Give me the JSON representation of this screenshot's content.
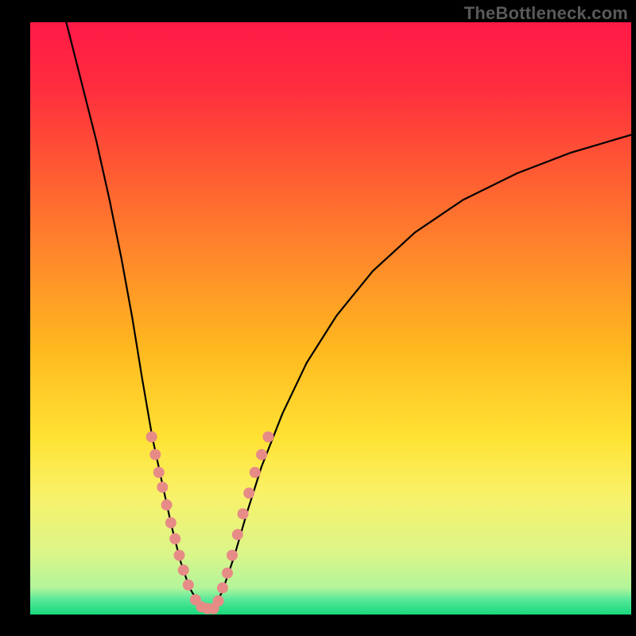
{
  "watermark": "TheBottleneck.com",
  "chart_data": {
    "type": "line",
    "title": "",
    "xlabel": "",
    "ylabel": "",
    "x_range": [
      0,
      100
    ],
    "y_range": [
      0,
      100
    ],
    "gradient_stops": [
      {
        "offset": 0.0,
        "color": "#ff1a47"
      },
      {
        "offset": 0.1,
        "color": "#ff2a3f"
      },
      {
        "offset": 0.25,
        "color": "#ff5a33"
      },
      {
        "offset": 0.4,
        "color": "#ff8a2a"
      },
      {
        "offset": 0.55,
        "color": "#ffb81f"
      },
      {
        "offset": 0.7,
        "color": "#ffe233"
      },
      {
        "offset": 0.8,
        "color": "#f8f26a"
      },
      {
        "offset": 0.9,
        "color": "#d9f58a"
      },
      {
        "offset": 0.955,
        "color": "#b3f59a"
      },
      {
        "offset": 0.975,
        "color": "#57e89a"
      },
      {
        "offset": 1.0,
        "color": "#17d87c"
      }
    ],
    "series": [
      {
        "name": "left-branch",
        "stroke": "#000000",
        "stroke_width": 2.2,
        "points": [
          {
            "x": 6.0,
            "y": 100.0
          },
          {
            "x": 8.5,
            "y": 90.0
          },
          {
            "x": 11.0,
            "y": 80.0
          },
          {
            "x": 13.2,
            "y": 70.0
          },
          {
            "x": 15.2,
            "y": 60.0
          },
          {
            "x": 17.0,
            "y": 50.0
          },
          {
            "x": 18.6,
            "y": 40.0
          },
          {
            "x": 20.3,
            "y": 30.0
          },
          {
            "x": 22.0,
            "y": 22.0
          },
          {
            "x": 23.5,
            "y": 15.0
          },
          {
            "x": 25.0,
            "y": 9.0
          },
          {
            "x": 26.5,
            "y": 4.5
          },
          {
            "x": 28.0,
            "y": 2.0
          },
          {
            "x": 29.0,
            "y": 1.0
          }
        ]
      },
      {
        "name": "right-branch",
        "stroke": "#000000",
        "stroke_width": 2.2,
        "points": [
          {
            "x": 30.5,
            "y": 1.0
          },
          {
            "x": 32.0,
            "y": 4.0
          },
          {
            "x": 34.0,
            "y": 10.0
          },
          {
            "x": 36.0,
            "y": 17.0
          },
          {
            "x": 38.5,
            "y": 25.0
          },
          {
            "x": 42.0,
            "y": 34.0
          },
          {
            "x": 46.0,
            "y": 42.5
          },
          {
            "x": 51.0,
            "y": 50.5
          },
          {
            "x": 57.0,
            "y": 58.0
          },
          {
            "x": 64.0,
            "y": 64.5
          },
          {
            "x": 72.0,
            "y": 70.0
          },
          {
            "x": 81.0,
            "y": 74.5
          },
          {
            "x": 90.0,
            "y": 78.0
          },
          {
            "x": 100.0,
            "y": 81.0
          }
        ]
      }
    ],
    "scatter": {
      "name": "data-points",
      "fill": "#e78b87",
      "radius": 7,
      "points": [
        {
          "x": 20.2,
          "y": 30.0
        },
        {
          "x": 20.8,
          "y": 27.0
        },
        {
          "x": 21.4,
          "y": 24.0
        },
        {
          "x": 22.0,
          "y": 21.5
        },
        {
          "x": 22.7,
          "y": 18.5
        },
        {
          "x": 23.4,
          "y": 15.5
        },
        {
          "x": 24.1,
          "y": 12.8
        },
        {
          "x": 24.8,
          "y": 10.0
        },
        {
          "x": 25.5,
          "y": 7.5
        },
        {
          "x": 26.3,
          "y": 5.0
        },
        {
          "x": 27.5,
          "y": 2.5
        },
        {
          "x": 28.5,
          "y": 1.3
        },
        {
          "x": 29.5,
          "y": 1.0
        },
        {
          "x": 30.5,
          "y": 1.0
        },
        {
          "x": 31.3,
          "y": 2.3
        },
        {
          "x": 32.0,
          "y": 4.5
        },
        {
          "x": 32.8,
          "y": 7.0
        },
        {
          "x": 33.6,
          "y": 10.0
        },
        {
          "x": 34.5,
          "y": 13.5
        },
        {
          "x": 35.4,
          "y": 17.0
        },
        {
          "x": 36.4,
          "y": 20.5
        },
        {
          "x": 37.4,
          "y": 24.0
        },
        {
          "x": 38.5,
          "y": 27.0
        },
        {
          "x": 39.6,
          "y": 30.0
        }
      ]
    }
  }
}
